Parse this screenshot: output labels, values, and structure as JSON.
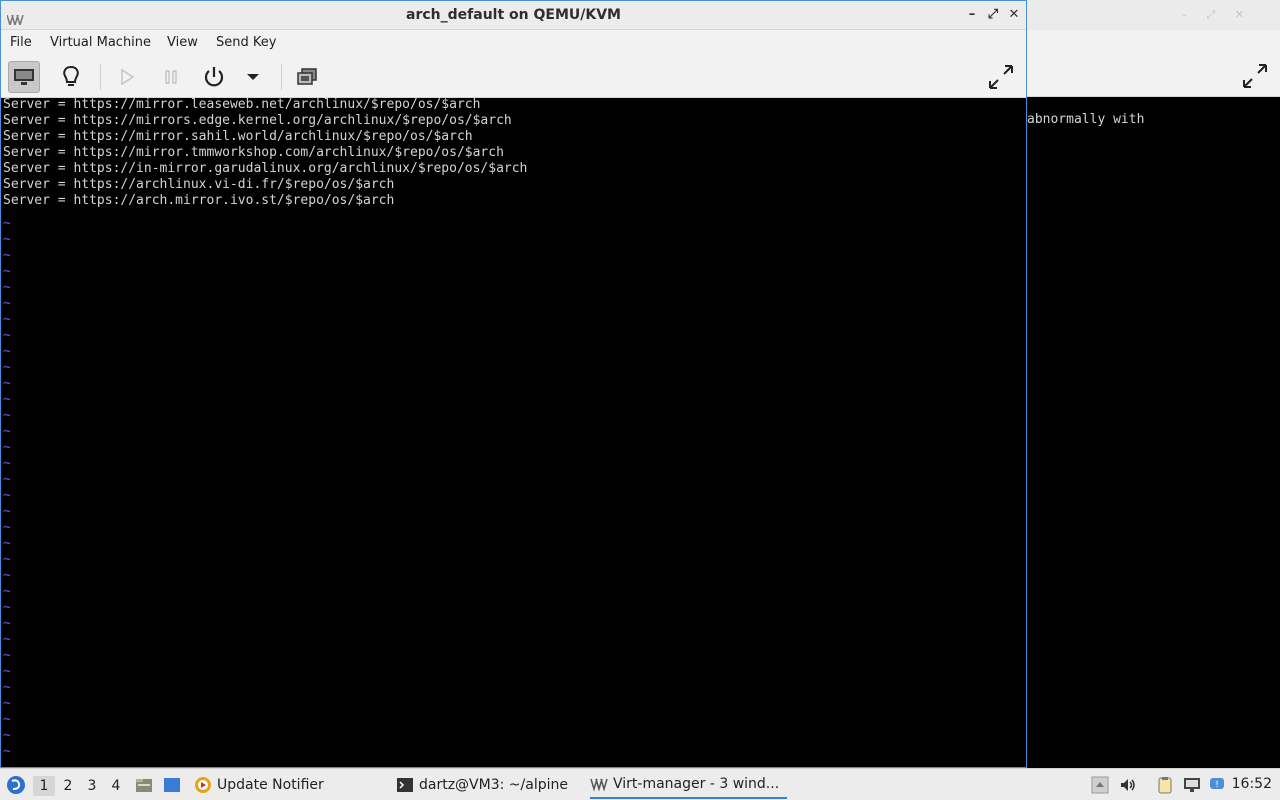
{
  "main_window": {
    "title": "arch_default on QEMU/KVM",
    "controls": {
      "minimize": "–",
      "maximize": "⤢",
      "close": "✕"
    },
    "menu": [
      "File",
      "Virtual Machine",
      "View",
      "Send Key"
    ]
  },
  "terminal": {
    "lines": [
      "Server = https://mirror.leaseweb.net/archlinux/$repo/os/$arch",
      "Server = https://mirrors.edge.kernel.org/archlinux/$repo/os/$arch",
      "Server = https://mirror.sahil.world/archlinux/$repo/os/$arch",
      "Server = https://mirror.tmmworkshop.com/archlinux/$repo/os/$arch",
      "Server = https://in-mirror.garudalinux.org/archlinux/$repo/os/$arch",
      "Server = https://archlinux.vi-di.fr/$repo/os/$arch",
      "Server = https://arch.mirror.ivo.st/$repo/os/$arch"
    ],
    "tilde": "~",
    "tilde_count": 34
  },
  "background_window": {
    "terminal_text": "abnormally with"
  },
  "taskbar": {
    "workspaces": [
      "1",
      "2",
      "3",
      "4"
    ],
    "tasks": [
      {
        "label": "Update Notifier",
        "icon": "update-notifier-icon"
      },
      {
        "label": "dartz@VM3: ~/alpine",
        "icon": "terminal-icon"
      },
      {
        "label": "Virt-manager - 3 wind...",
        "icon": "virt-manager-icon"
      }
    ],
    "clock": "16:52"
  },
  "colors": {
    "accent": "#4a8fde",
    "tilde": "#5b5bff",
    "terminal_text": "#d4d4d4"
  }
}
